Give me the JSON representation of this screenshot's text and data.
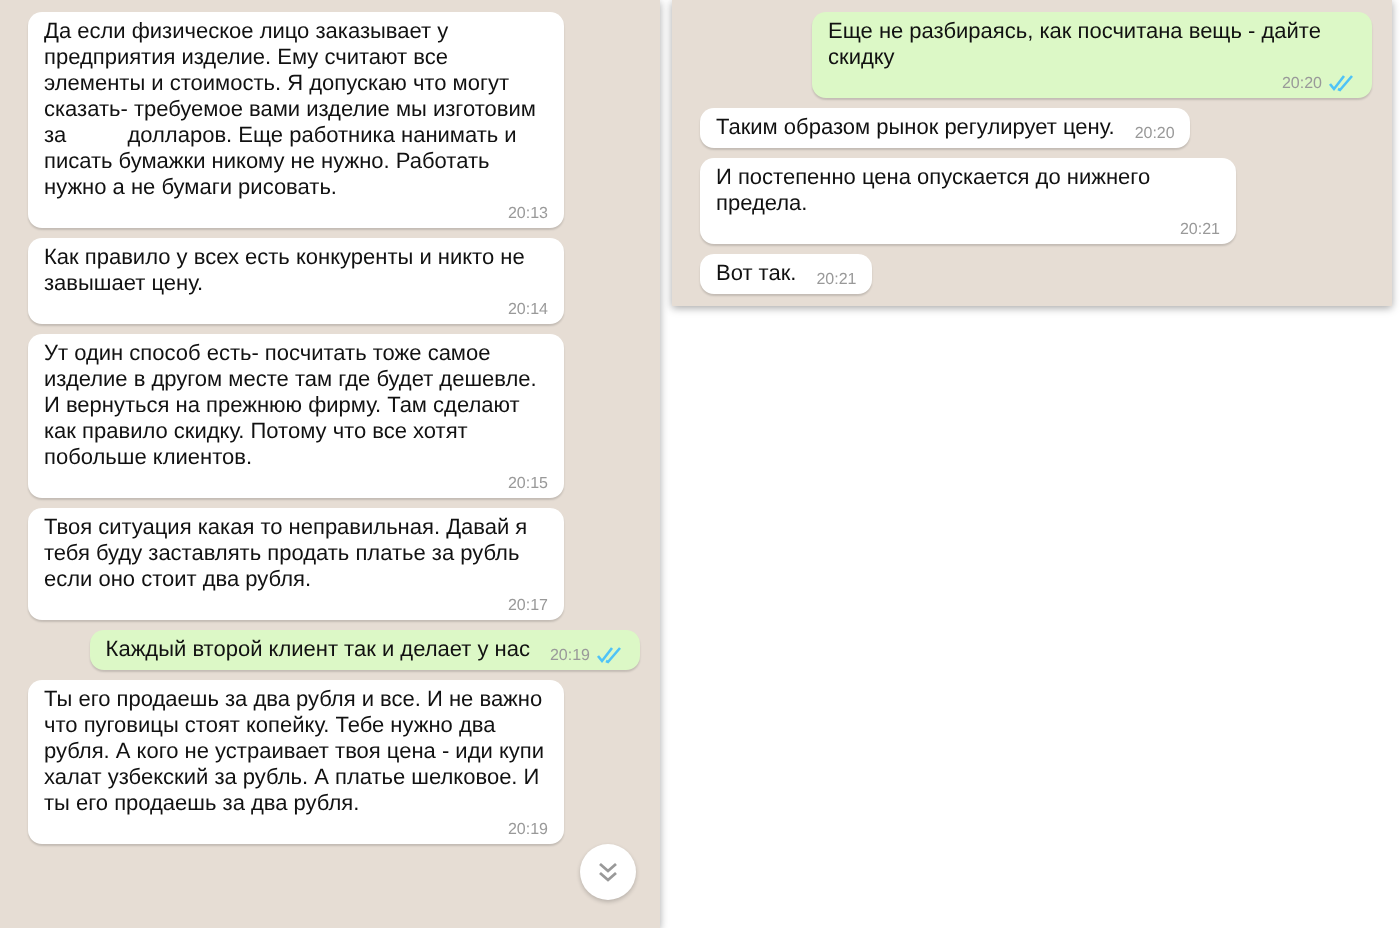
{
  "panels": [
    {
      "messages": [
        {
          "kind": "incoming",
          "text": "Да если физическое лицо заказывает у предприятия изделие. Ему считают все элементы и стоимость. Я допускаю что могут сказать- требуемое вами изделие мы изготовим за          долларов. Еще работника нанимать и писать бумажки никому не нужно. Работать нужно а не бумаги рисовать.",
          "time": "20:13"
        },
        {
          "kind": "incoming",
          "text": "Как правило у всех есть конкуренты и никто не завышает цену.",
          "time": "20:14"
        },
        {
          "kind": "incoming",
          "text": "Ут один способ есть- посчитать тоже самое изделие в другом месте там где будет дешевле. И вернуться на прежнюю фирму. Там сделают как правило скидку. Потому что все хотят побольше клиентов.",
          "time": "20:15"
        },
        {
          "kind": "incoming",
          "text": "Твоя ситуация какая то неправильная. Давай я тебя буду заставлять продать платье за рубль если оно стоит два рубля.",
          "time": "20:17"
        },
        {
          "kind": "outgoing",
          "text": "Каждый второй клиент так и делает у нас",
          "time": "20:19",
          "read": true
        },
        {
          "kind": "incoming",
          "text": "Ты его продаешь за два рубля и все. И не важно что пуговицы стоят копейку. Тебе нужно два рубля. А кого не устраивает твоя цена - иди купи халат узбекский за рубль. А платье шелковое. И ты его продаешь за два рубля.",
          "time": "20:19"
        }
      ],
      "scroll_button": true
    },
    {
      "messages": [
        {
          "kind": "outgoing",
          "text": "Еще не разбираясь, как посчитана вещь - дайте скидку",
          "time": "20:20",
          "read": true
        },
        {
          "kind": "incoming",
          "text": "Таким образом рынок регулирует цену.",
          "time": "20:20"
        },
        {
          "kind": "incoming",
          "text": "И постепенно цена опускается до нижнего предела.",
          "time": "20:21"
        },
        {
          "kind": "incoming",
          "text": "Вот так.",
          "time": "20:21"
        }
      ],
      "scroll_button": false
    }
  ]
}
